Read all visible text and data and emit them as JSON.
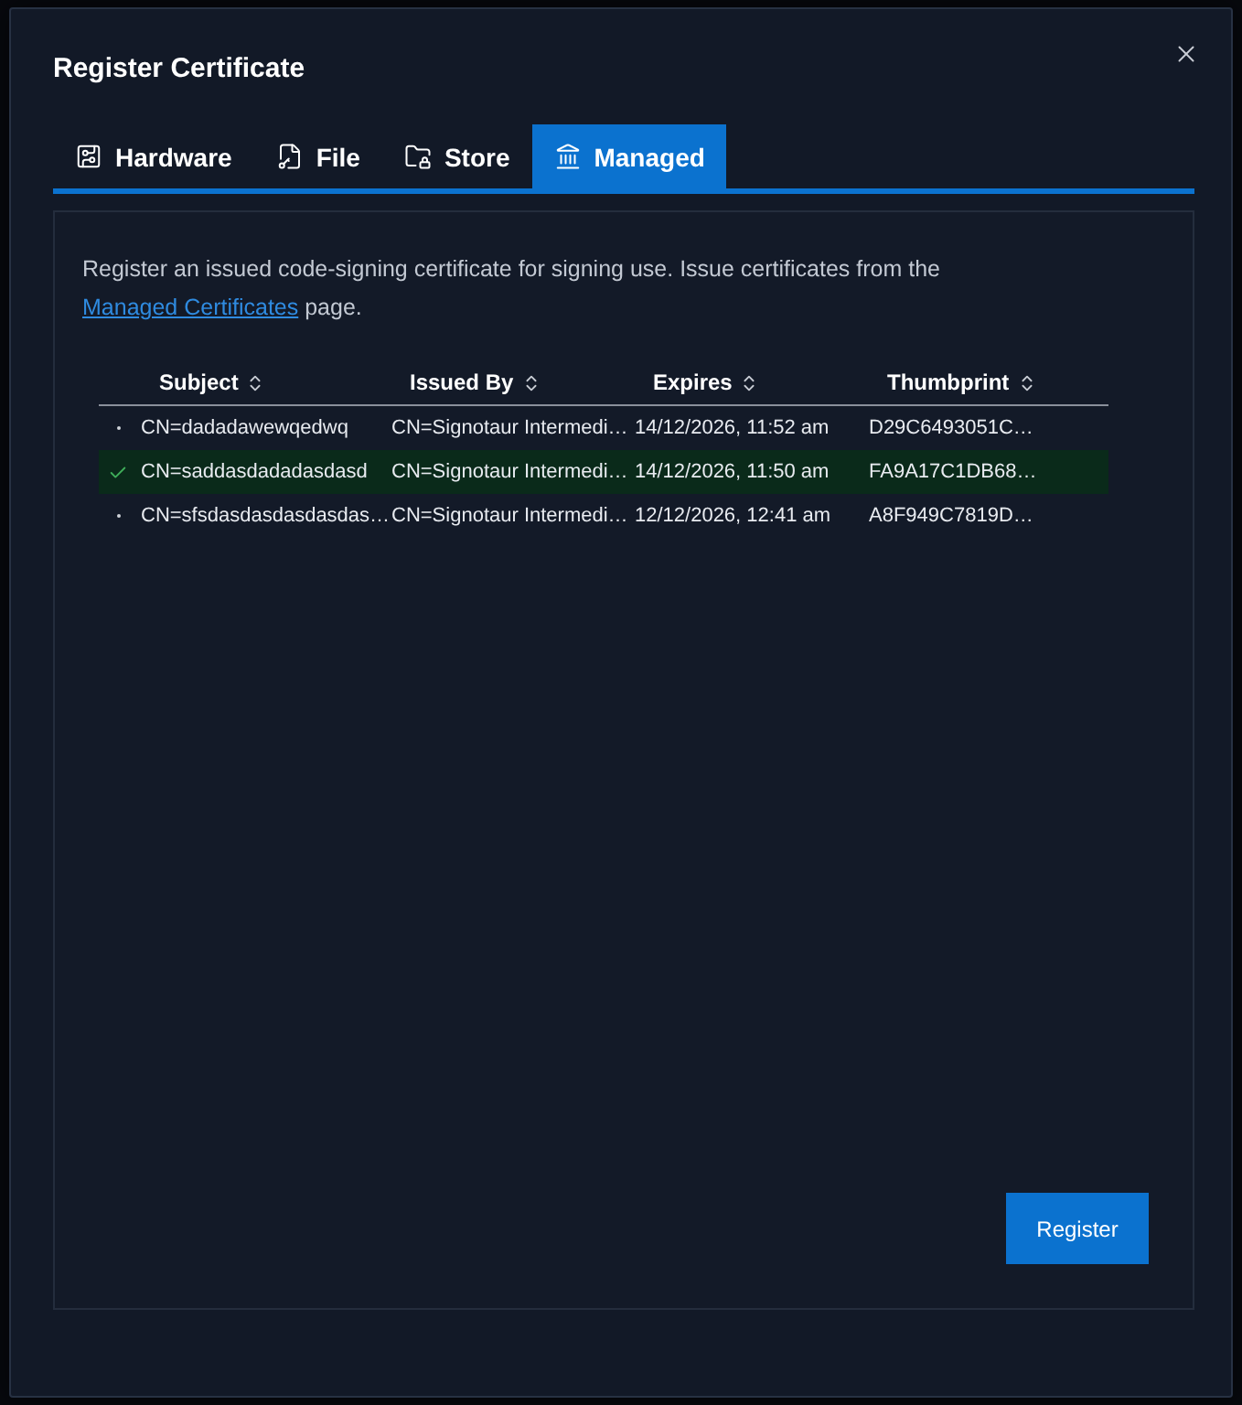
{
  "dialog": {
    "title": "Register Certificate"
  },
  "tabs": [
    {
      "label": "Hardware",
      "kind": "hardware",
      "selected": false
    },
    {
      "label": "File",
      "kind": "file",
      "selected": false
    },
    {
      "label": "Store",
      "kind": "store",
      "selected": false
    },
    {
      "label": "Managed",
      "kind": "managed",
      "selected": true
    }
  ],
  "description": {
    "text": "Register an issued code-signing certificate for signing use. Issue certificates from the ",
    "link": "Managed Certificates",
    "text_after": " page."
  },
  "table": {
    "columns": [
      {
        "label": "Subject"
      },
      {
        "label": "Issued By"
      },
      {
        "label": "Expires"
      },
      {
        "label": "Thumbprint"
      }
    ],
    "rows": [
      {
        "selected": false,
        "subject": "CN=dadadawewqedwq",
        "issued_by": "CN=Signotaur Intermedi…",
        "expires": "14/12/2026, 11:52 am",
        "thumbprint": "D29C6493051C…"
      },
      {
        "selected": true,
        "subject": "CN=saddasdadadasdasd",
        "issued_by": "CN=Signotaur Intermedi…",
        "expires": "14/12/2026, 11:50 am",
        "thumbprint": "FA9A17C1DB68…"
      },
      {
        "selected": false,
        "subject": "CN=sfsdasdasdasdasdas…",
        "issued_by": "CN=Signotaur Intermedi…",
        "expires": "12/12/2026, 12:41 am",
        "thumbprint": "A8F949C7819D…"
      }
    ]
  },
  "buttons": {
    "register": "Register"
  }
}
